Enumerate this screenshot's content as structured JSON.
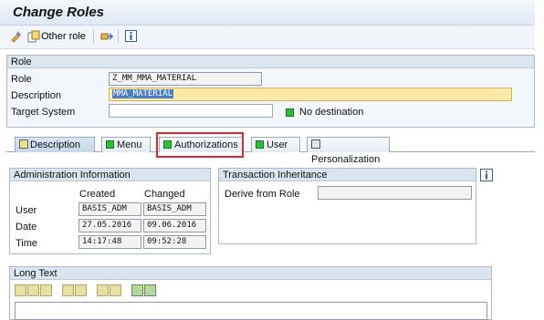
{
  "header": {
    "title": "Change Roles"
  },
  "toolbar": {
    "other_role_label": "Other role"
  },
  "role_panel": {
    "header": "Role",
    "role_label": "Role",
    "role_value": "Z_MM_MMA_MATERIAL",
    "description_label": "Description",
    "description_value": "MMA_MATERIAL",
    "target_system_label": "Target System",
    "target_system_value": "",
    "no_destination_label": "No destination"
  },
  "tabs": [
    {
      "label": "Description"
    },
    {
      "label": "Menu"
    },
    {
      "label": "Authorizations"
    },
    {
      "label": "User"
    },
    {
      "label": "Personalization"
    }
  ],
  "admin": {
    "header": "Administration Information",
    "col_created": "Created",
    "col_changed": "Changed",
    "rows": [
      {
        "label": "User",
        "created": "BASIS_ADM",
        "changed": "BASIS_ADM"
      },
      {
        "label": "Date",
        "created": "27.05.2016",
        "changed": "09.06.2016"
      },
      {
        "label": "Time",
        "created": "14:17:48",
        "changed": "09:52:28"
      }
    ]
  },
  "inheritance": {
    "header": "Transaction Inheritance",
    "derive_label": "Derive from Role",
    "derive_value": ""
  },
  "long_text": {
    "header": "Long Text"
  },
  "colors": {
    "status_green": "#2ebd3a",
    "highlight_red": "#e0282d",
    "panel_border": "#a9bacd"
  }
}
